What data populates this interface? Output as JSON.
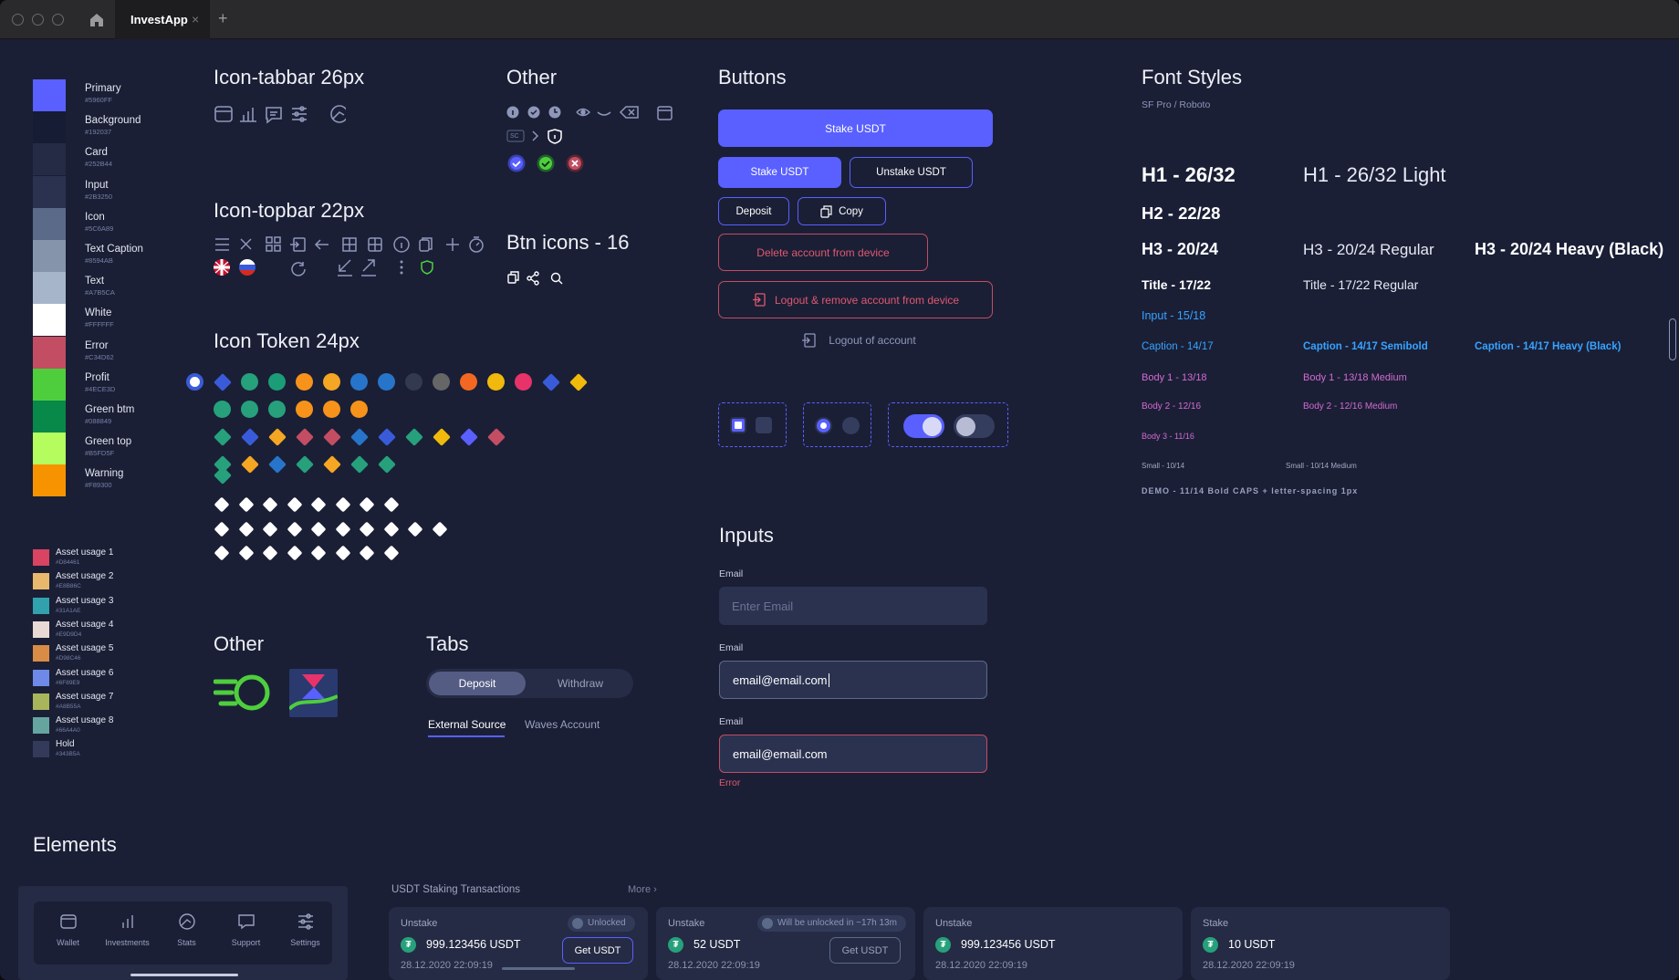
{
  "window": {
    "tab_title": "InvestApp",
    "tab_close": "×",
    "new_tab": "+"
  },
  "palette": [
    {
      "name": "Primary",
      "hex": "#5960FF",
      "color": "#5960ff"
    },
    {
      "name": "Background",
      "hex": "#192037",
      "color": "#161c33"
    },
    {
      "name": "Card",
      "hex": "#252B44",
      "color": "#252b44"
    },
    {
      "name": "Input",
      "hex": "#2B3250",
      "color": "#2b3250"
    },
    {
      "name": "Icon",
      "hex": "#5C6A89",
      "color": "#5c6a89"
    },
    {
      "name": "Text Caption",
      "hex": "#8594AB",
      "color": "#8594ab"
    },
    {
      "name": "Text",
      "hex": "#A7B5CA",
      "color": "#a7b5ca"
    },
    {
      "name": "White",
      "hex": "#FFFFFF",
      "color": "#ffffff"
    },
    {
      "name": "Error",
      "hex": "#C34D62",
      "color": "#c34d62"
    },
    {
      "name": "Profit",
      "hex": "#4ECE3D",
      "color": "#4ece3d"
    },
    {
      "name": "Green btm",
      "hex": "#088849",
      "color": "#088849"
    },
    {
      "name": "Green top",
      "hex": "#B5FD5F",
      "color": "#b5fd5f"
    },
    {
      "name": "Warning",
      "hex": "#F89300",
      "color": "#f89300"
    }
  ],
  "assets": [
    {
      "name": "Asset usage 1",
      "hex": "#D84461",
      "color": "#d84461"
    },
    {
      "name": "Asset usage 2",
      "hex": "#E8B86C",
      "color": "#e8b86c"
    },
    {
      "name": "Asset usage 3",
      "hex": "#31A1AE",
      "color": "#31a1ae"
    },
    {
      "name": "Asset usage 4",
      "hex": "#E9D9D4",
      "color": "#e9d9d4"
    },
    {
      "name": "Asset usage 5",
      "hex": "#D98C46",
      "color": "#d98c46"
    },
    {
      "name": "Asset usage 6",
      "hex": "#6F89E9",
      "color": "#6f89e9"
    },
    {
      "name": "Asset usage 7",
      "hex": "#A8B55A",
      "color": "#a8b55a"
    },
    {
      "name": "Asset usage 8",
      "hex": "#66A4A0",
      "color": "#66a4a0"
    },
    {
      "name": "Hold",
      "hex": "#343B5A",
      "color": "#343b5a"
    }
  ],
  "sections": {
    "icon_tabbar": "Icon-tabbar 26px",
    "other_top": "Other",
    "buttons": "Buttons",
    "font_styles": "Font Styles",
    "icon_topbar": "Icon-topbar 22px",
    "btn_icons": "Btn icons - 16",
    "icon_token": "Icon Token 24px",
    "other_bottom": "Other",
    "tabs": "Tabs",
    "inputs": "Inputs",
    "elements": "Elements"
  },
  "other_icons": {
    "sc_label": "SC"
  },
  "buttons": {
    "stake_full": "Stake USDT",
    "stake": "Stake USDT",
    "unstake": "Unstake USDT",
    "deposit": "Deposit",
    "copy": "Copy",
    "delete_account": "Delete account from device",
    "logout_remove": "Logout & remove account from device",
    "logout": "Logout of account"
  },
  "tabs": {
    "segment_active": "Deposit",
    "segment_inactive": "Withdraw",
    "underline_active": "External Source",
    "underline_inactive": "Waves Account"
  },
  "inputs": {
    "label1": "Email",
    "placeholder1": "Enter Email",
    "label2": "Email",
    "value2": "email@email.com",
    "label3": "Email",
    "value3": "email@email.com",
    "error": "Error"
  },
  "fonts": {
    "subtitle": "SF Pro / Roboto",
    "h1": "H1 - 26/32",
    "h1_light": "H1 - 26/32 Light",
    "h2": "H2 - 22/28",
    "h3": "H3 - 20/24",
    "h3_regular": "H3 - 20/24 Regular",
    "h3_heavy": "H3 - 20/24 Heavy (Black)",
    "title": "Title - 17/22",
    "title_regular": "Title - 17/22 Regular",
    "input": "Input - 15/18",
    "caption": "Caption - 14/17",
    "caption_semibold": "Caption - 14/17 Semibold",
    "caption_heavy": "Caption - 14/17 Heavy (Black)",
    "body1": "Body 1 - 13/18",
    "body1_medium": "Body 1 - 13/18 Medium",
    "body2": "Body 2 - 12/16",
    "body2_medium": "Body 2 - 12/16 Medium",
    "body3": "Body 3 - 11/16",
    "small": "Small - 10/14",
    "small_medium": "Small - 10/14 Medium",
    "demo": "DEMO - 11/14 Bold CAPS + letter-spacing 1px"
  },
  "tabbar": [
    {
      "label": "Wallet"
    },
    {
      "label": "Investments"
    },
    {
      "label": "Stats"
    },
    {
      "label": "Support"
    },
    {
      "label": "Settings"
    }
  ],
  "staking": {
    "title": "USDT Staking Transactions",
    "more": "More",
    "cards": [
      {
        "type": "Unstake",
        "amount": "999.123456 USDT",
        "date": "28.12.2020 22:09:19",
        "badge": "Unlocked",
        "button": "Get USDT"
      },
      {
        "type": "Unstake",
        "amount": "52 USDT",
        "date": "28.12.2020 22:09:19",
        "badge": "Will be unlocked in ~17h 13m",
        "button": "Get USDT"
      },
      {
        "type": "Unstake",
        "amount": "999.123456 USDT",
        "date": "28.12.2020 22:09:19"
      },
      {
        "type": "Stake",
        "amount": "10 USDT",
        "date": "28.12.2020 22:09:19"
      }
    ]
  }
}
